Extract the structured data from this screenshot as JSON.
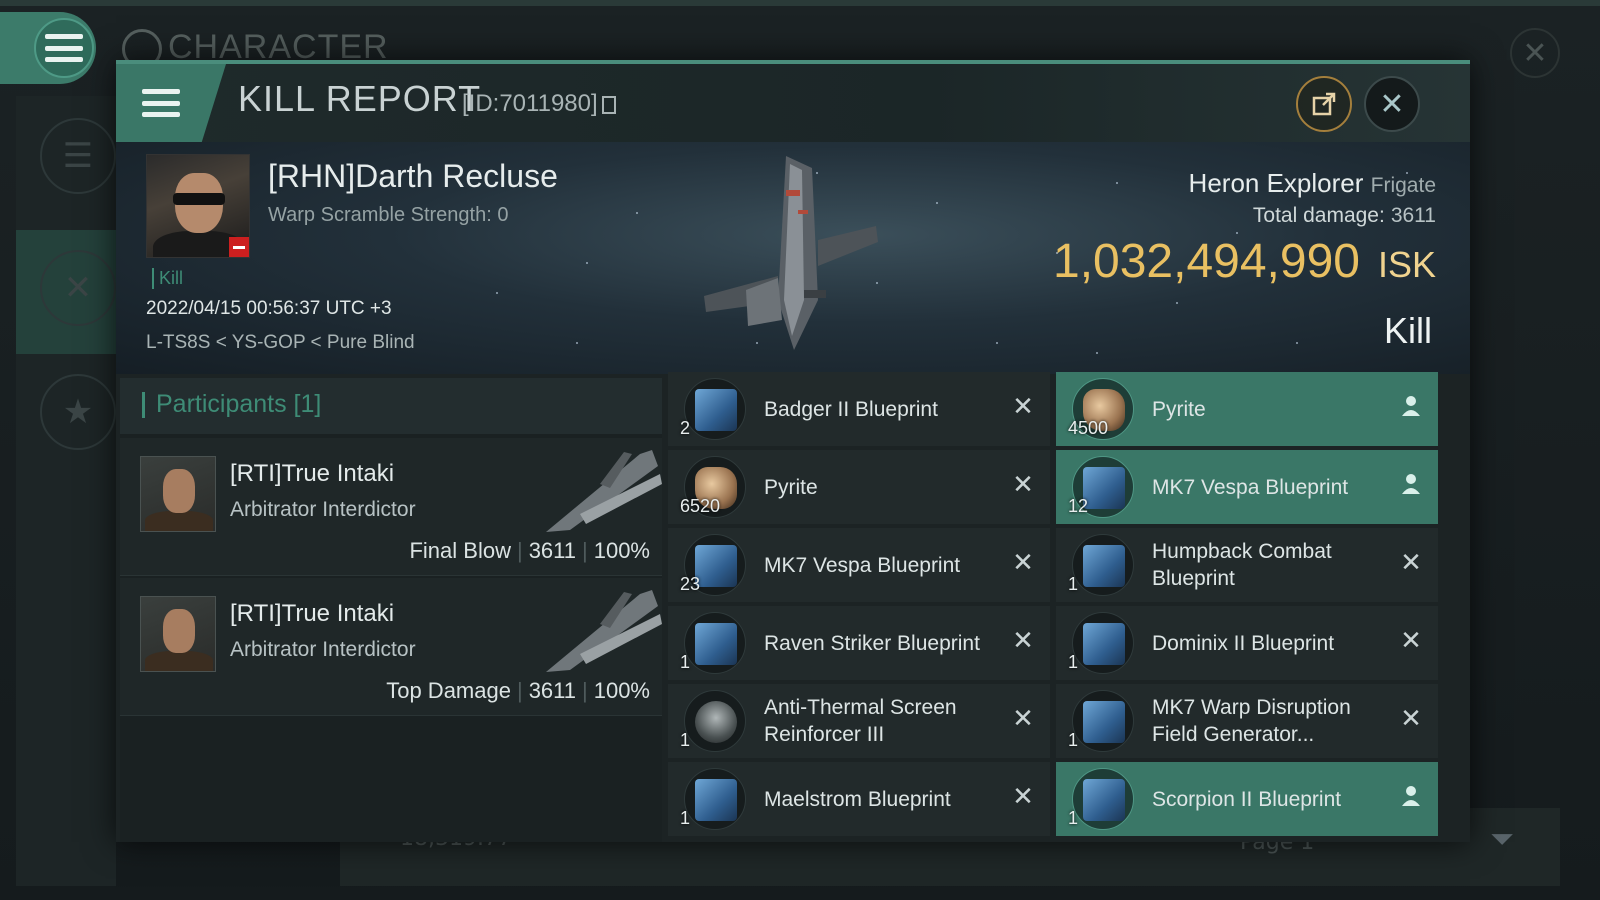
{
  "background": {
    "title": "CHARACTER",
    "bottom_value": "18,319.77",
    "page_label": "Page 1"
  },
  "header": {
    "title": "KILL REPORT",
    "id_label": "[ID:7011980]"
  },
  "victim": {
    "name": "[RHN]Darth Recluse",
    "subtitle": "Warp Scramble Strength: 0",
    "tag": "Kill",
    "datetime": "2022/04/15 00:56:37 UTC +3",
    "location": "L-TS8S < YS-GOP < Pure Blind",
    "ship_name": "Heron Explorer",
    "ship_class": "Frigate",
    "total_damage_label": "Total damage:",
    "total_damage_value": "3611",
    "isk_amount": "1,032,494,990",
    "isk_currency": "ISK",
    "result_label": "Kill"
  },
  "participants": {
    "header": "Participants [1]",
    "rows": [
      {
        "name": "[RTI]True Intaki",
        "ship": "Arbitrator Interdictor",
        "role": "Final Blow",
        "damage": "3611",
        "percent": "100%"
      },
      {
        "name": "[RTI]True Intaki",
        "ship": "Arbitrator Interdictor",
        "role": "Top Damage",
        "damage": "3611",
        "percent": "100%"
      }
    ]
  },
  "items": [
    {
      "name": "Badger II Blueprint",
      "qty": "2",
      "status": "destroyed",
      "icon": "blueprint-icon"
    },
    {
      "name": "Pyrite",
      "qty": "4500",
      "status": "dropped",
      "icon": "ore-icon"
    },
    {
      "name": "Pyrite",
      "qty": "6520",
      "status": "destroyed",
      "icon": "ore-icon"
    },
    {
      "name": "MK7 Vespa Blueprint",
      "qty": "12",
      "status": "dropped",
      "icon": "blueprint-icon"
    },
    {
      "name": "MK7 Vespa Blueprint",
      "qty": "23",
      "status": "destroyed",
      "icon": "blueprint-icon"
    },
    {
      "name": "Humpback Combat Blueprint",
      "qty": "1",
      "status": "destroyed",
      "icon": "blueprint-icon"
    },
    {
      "name": "Raven Striker Blueprint",
      "qty": "1",
      "status": "destroyed",
      "icon": "blueprint-icon"
    },
    {
      "name": "Dominix II Blueprint",
      "qty": "1",
      "status": "destroyed",
      "icon": "blueprint-icon"
    },
    {
      "name": "Anti-Thermal Screen Reinforcer III",
      "qty": "1",
      "status": "destroyed",
      "icon": "module-icon"
    },
    {
      "name": "MK7 Warp Disruption Field Generator...",
      "qty": "1",
      "status": "destroyed",
      "icon": "blueprint-icon"
    },
    {
      "name": "Maelstrom Blueprint",
      "qty": "1",
      "status": "destroyed",
      "icon": "blueprint-icon"
    },
    {
      "name": "Scorpion II Blueprint",
      "qty": "1",
      "status": "dropped",
      "icon": "blueprint-icon"
    }
  ],
  "colors": {
    "accent": "#3a7767",
    "isk": "#e9c062",
    "participants_header": "#3e8c76"
  }
}
